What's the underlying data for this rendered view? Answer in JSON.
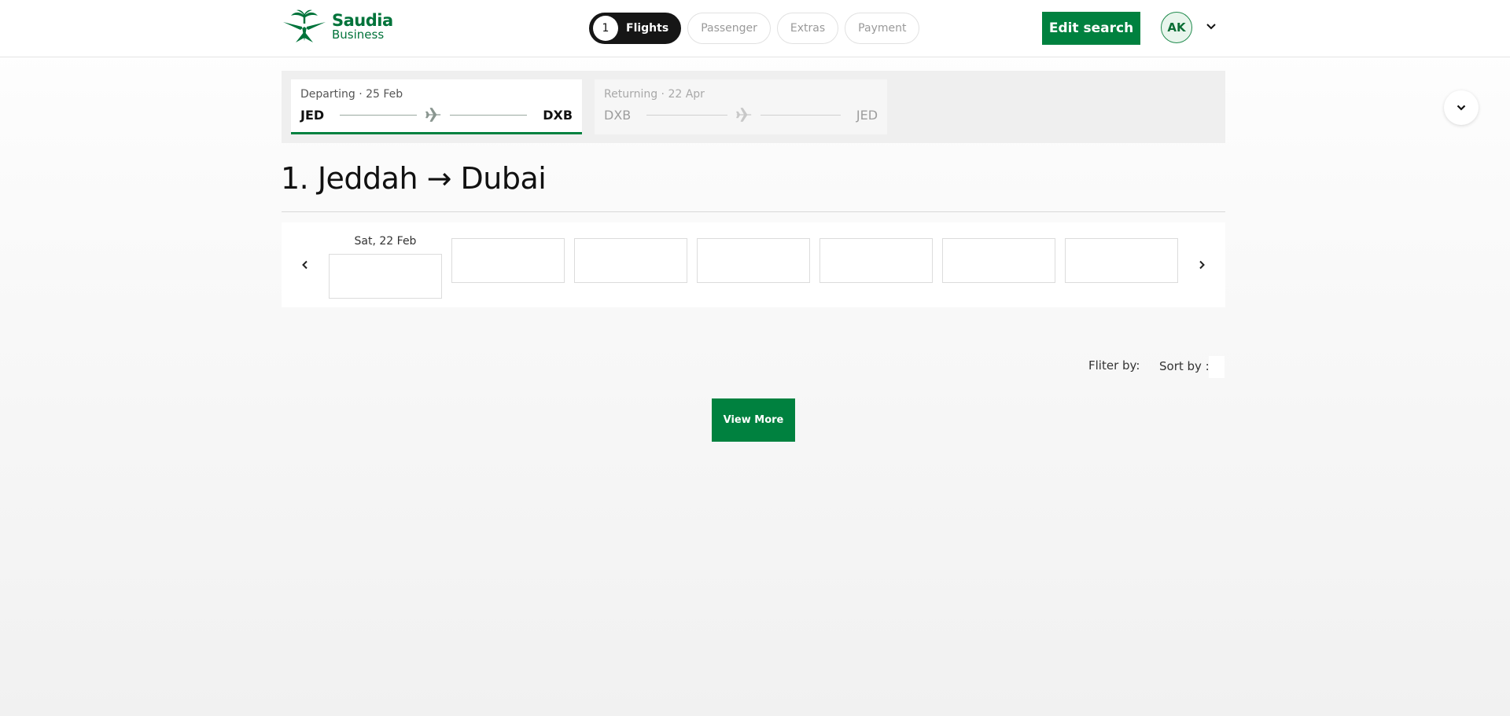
{
  "brand": {
    "name": "Saudia",
    "sub": "Business",
    "color": "#00733a"
  },
  "stepper": {
    "steps": [
      {
        "number": "1",
        "label": "Flights",
        "active": true
      },
      {
        "label": "Passenger",
        "active": false
      },
      {
        "label": "Extras",
        "active": false
      },
      {
        "label": "Payment",
        "active": false
      }
    ]
  },
  "header": {
    "edit_search": "Edit search",
    "avatar_initials": "AK",
    "icons": {
      "account_menu": "chevron-down-icon"
    }
  },
  "legs": {
    "departing": {
      "label": "Departing · 25 Feb",
      "from": "JED",
      "to": "DXB",
      "selected": true,
      "icon": "airplane-icon"
    },
    "returning": {
      "label": "Returning · 22 Apr",
      "from": "DXB",
      "to": "JED",
      "selected": false,
      "icon": "airplane-icon"
    },
    "expand_icon": "chevron-down-icon"
  },
  "title": "1. Jeddah → Dubai",
  "dates": {
    "selected_label": "Sat, 22 Feb",
    "prev_icon": "chevron-left-icon",
    "next_icon": "chevron-right-icon"
  },
  "filters": {
    "filter_by": "Fliter by:",
    "sort_by": "Sort by :"
  },
  "view_more": "View More",
  "colors": {
    "primary_green": "#00813f",
    "dark_pill": "#161616"
  }
}
